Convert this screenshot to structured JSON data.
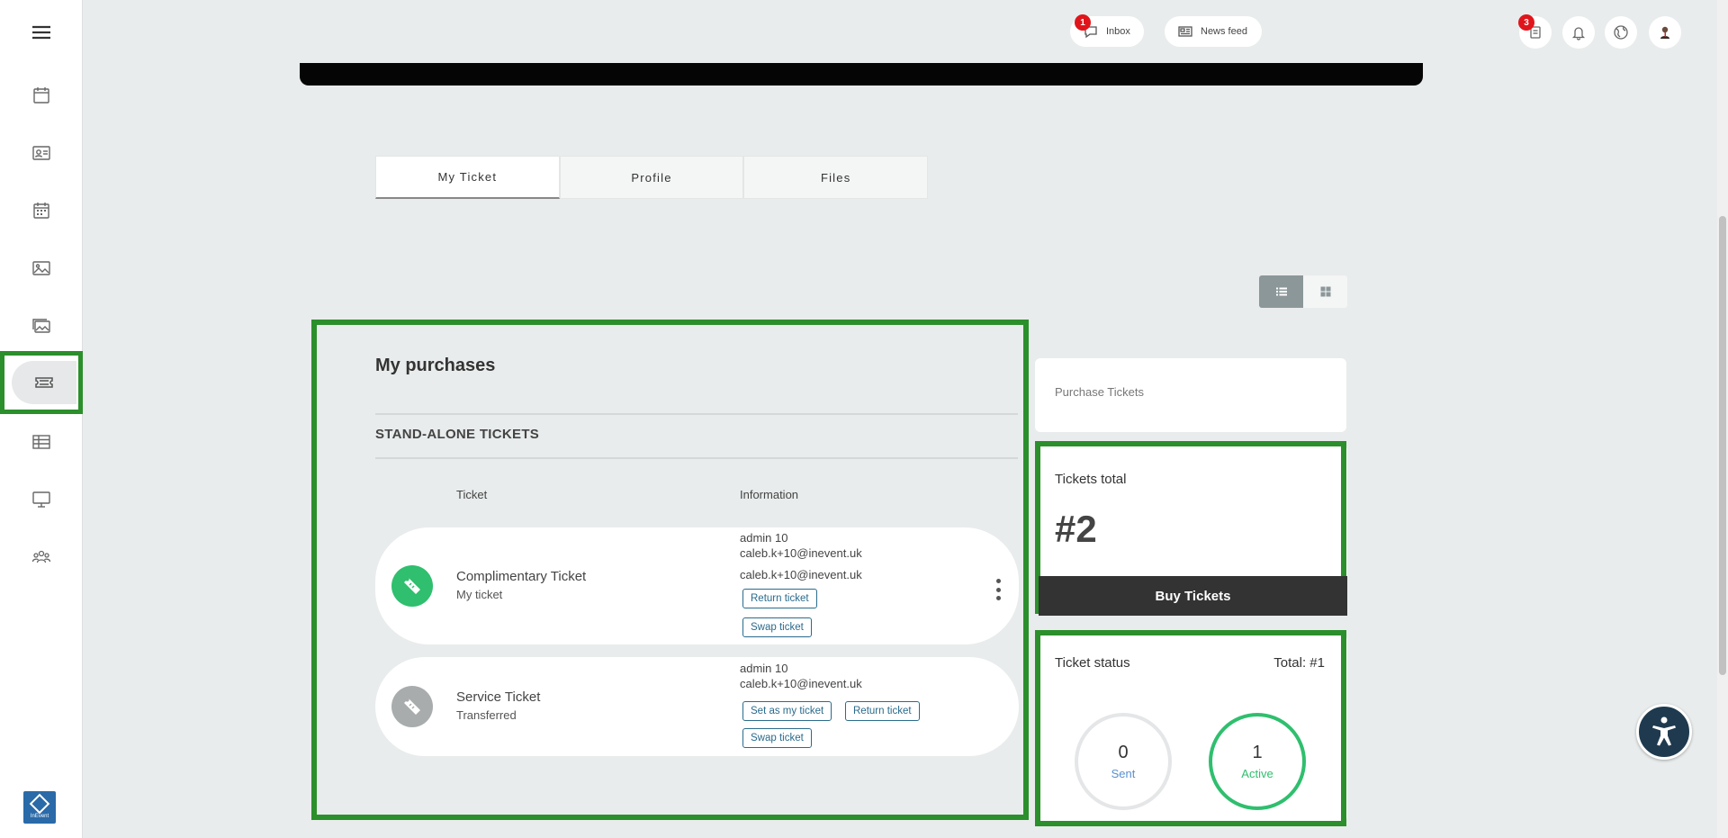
{
  "topbar": {
    "inbox_label": "Inbox",
    "inbox_badge": "1",
    "newsfeed_label": "News feed",
    "cart_badge": "3"
  },
  "sidebar": {
    "items": [
      {
        "icon": "menu-icon"
      },
      {
        "icon": "calendar-icon"
      },
      {
        "icon": "id-card-icon"
      },
      {
        "icon": "schedule-icon"
      },
      {
        "icon": "image-icon"
      },
      {
        "icon": "gallery-icon"
      },
      {
        "icon": "ticket-icon",
        "active": true
      },
      {
        "icon": "table-icon"
      },
      {
        "icon": "monitor-icon"
      },
      {
        "icon": "people-icon"
      }
    ],
    "logo_text": "InEvent"
  },
  "tabs": [
    {
      "label": "My Ticket",
      "active": true
    },
    {
      "label": "Profile",
      "active": false
    },
    {
      "label": "Files",
      "active": false
    }
  ],
  "purchases": {
    "title": "My purchases",
    "section": "STAND-ALONE TICKETS",
    "col_ticket": "Ticket",
    "col_information": "Information",
    "tickets": [
      {
        "name": "Complimentary Ticket",
        "subtitle": "My ticket",
        "info_name": "admin 10",
        "info_email": "caleb.k+10@inevent.uk",
        "info_email2": "caleb.k+10@inevent.uk",
        "actions": [
          "Return ticket",
          "Swap ticket"
        ],
        "icon_color": "#2fbf6e"
      },
      {
        "name": "Service Ticket",
        "subtitle": "Transferred",
        "info_name": "admin 10",
        "info_email": "caleb.k+10@inevent.uk",
        "actions": [
          "Set as my ticket",
          "Return ticket",
          "Swap ticket"
        ],
        "icon_color": "#a8acad"
      }
    ]
  },
  "right": {
    "purchase_tickets_link": "Purchase Tickets",
    "tickets_total_label": "Tickets total",
    "tickets_total_value": "#2",
    "buy_button": "Buy Tickets",
    "ticket_status_label": "Ticket status",
    "ticket_status_total": "Total: #1",
    "status": [
      {
        "value": "0",
        "label": "Sent",
        "color": "#5a8fd1",
        "ring": "#e4e6e7"
      },
      {
        "value": "1",
        "label": "Active",
        "color": "#2fbf6e",
        "ring": "#2fbf6e"
      }
    ]
  },
  "colors": {
    "highlight": "#2b8f2b",
    "accent_green": "#2fbf6e",
    "badge_red": "#e0151b",
    "chip_blue": "#2a6b8c"
  }
}
